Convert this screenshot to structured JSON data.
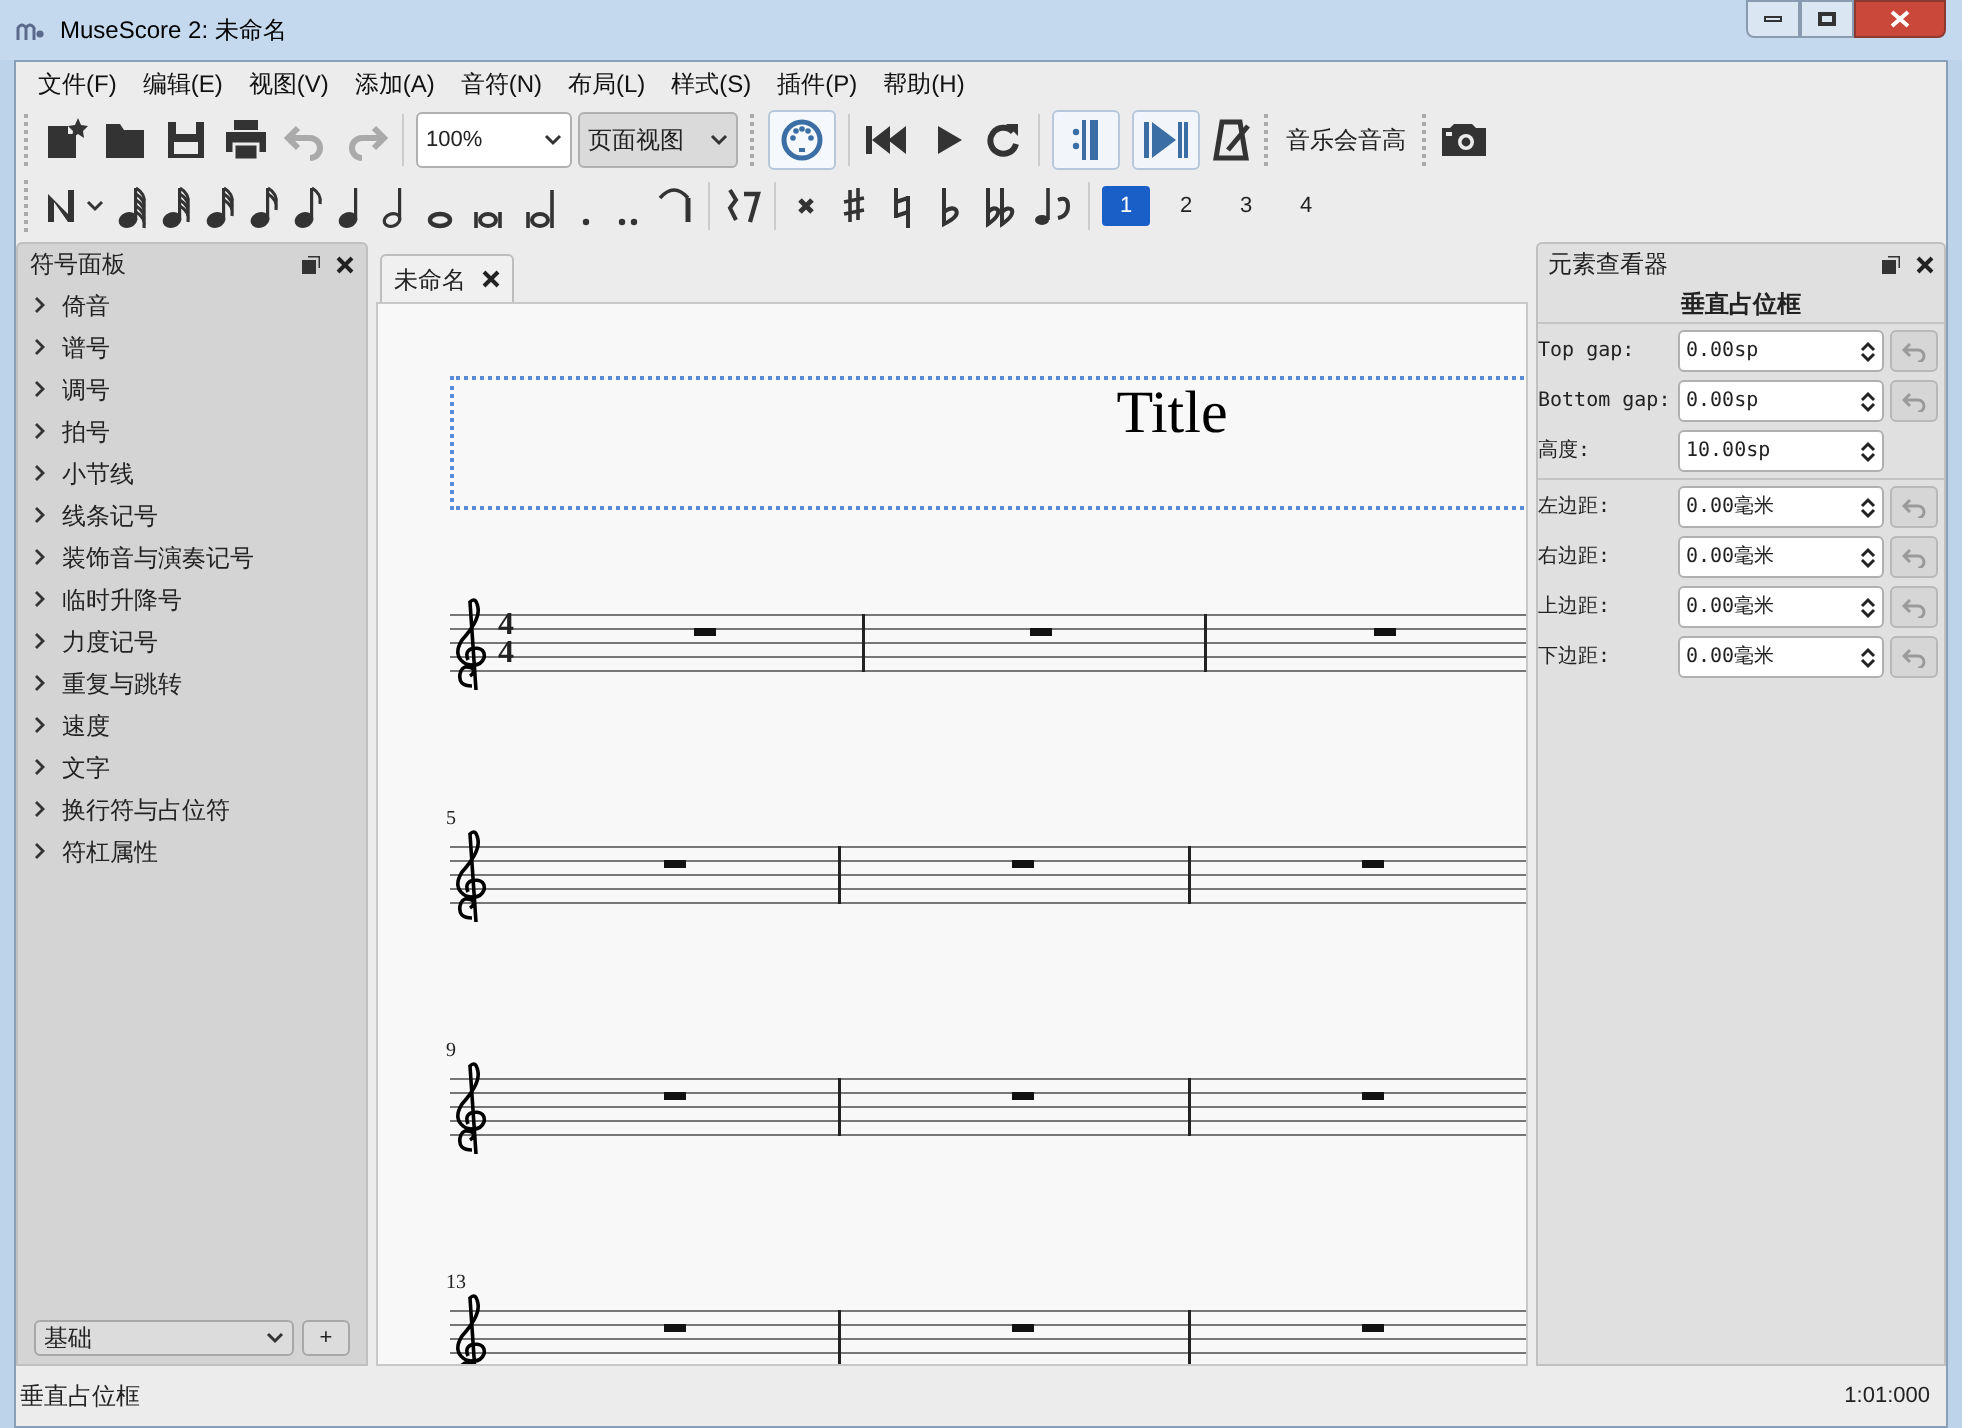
{
  "window": {
    "title": "MuseScore 2: 未命名"
  },
  "menu": [
    "文件(F)",
    "编辑(E)",
    "视图(V)",
    "添加(A)",
    "音符(N)",
    "布局(L)",
    "样式(S)",
    "插件(P)",
    "帮助(H)"
  ],
  "toolbar": {
    "undo": {
      "disabled": true
    },
    "redo": {
      "disabled": true
    },
    "zoom": "100%",
    "view": "页面视图",
    "repeat_playback": {
      "on": true
    },
    "pan": {
      "on": true
    },
    "concert_pitch": "音乐会音高"
  },
  "voices": [
    {
      "label": "1",
      "selected": true
    },
    {
      "label": "2",
      "selected": false
    },
    {
      "label": "3",
      "selected": false
    },
    {
      "label": "4",
      "selected": false
    }
  ],
  "palette": {
    "title": "符号面板",
    "items": [
      "倚音",
      "谱号",
      "调号",
      "拍号",
      "小节线",
      "线条记号",
      "装饰音与演奏记号",
      "临时升降号",
      "力度记号",
      "重复与跳转",
      "速度",
      "文字",
      "换行符与占位符",
      "符杠属性"
    ],
    "workspace": "基础",
    "add": "+"
  },
  "score_tabs": [
    {
      "label": "未命名",
      "selected": true
    }
  ],
  "score": {
    "title": "Title",
    "systems": [
      {
        "time_signature": [
          "4",
          "4"
        ]
      },
      {
        "measure_number": "5"
      },
      {
        "measure_number": "9"
      },
      {
        "measure_number": "13"
      }
    ]
  },
  "inspector": {
    "title": "元素查看器",
    "heading": "垂直占位框",
    "groups": [
      [
        {
          "label": "Top gap:",
          "value": "0.00sp",
          "reset": true
        },
        {
          "label": "Bottom gap:",
          "value": "0.00sp",
          "reset": true
        },
        {
          "label": "高度:",
          "value": "10.00sp",
          "reset": false
        }
      ],
      [
        {
          "label": "左边距:",
          "value": "0.00毫米",
          "reset": true
        },
        {
          "label": "右边距:",
          "value": "0.00毫米",
          "reset": true
        },
        {
          "label": "上边距:",
          "value": "0.00毫米",
          "reset": true
        },
        {
          "label": "下边距:",
          "value": "0.00毫米",
          "reset": true
        }
      ]
    ]
  },
  "status_bar": {
    "message": "垂直占位框",
    "position": "1:01:000"
  }
}
